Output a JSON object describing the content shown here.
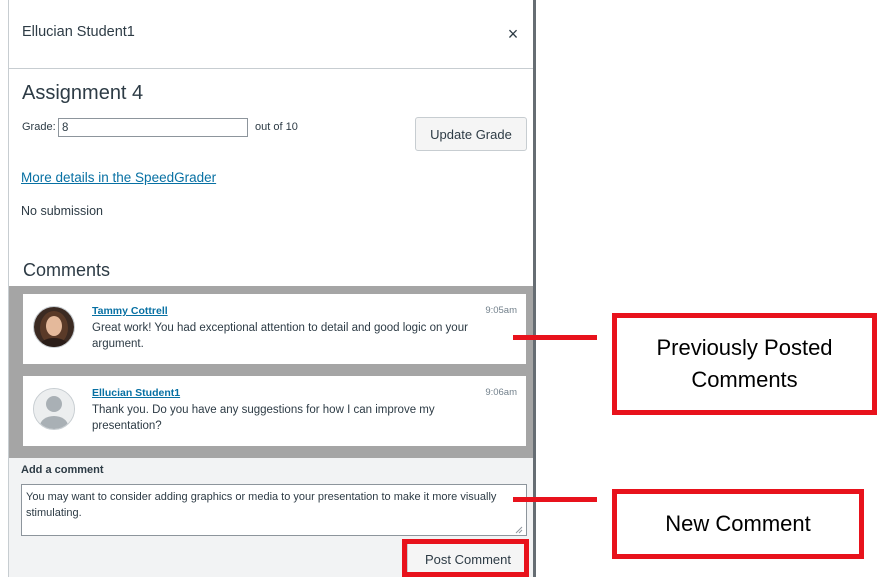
{
  "dialog": {
    "title": "Ellucian Student1",
    "close_label": "×"
  },
  "assignment": {
    "title": "Assignment 4",
    "grade_label": "Grade:",
    "grade_value": "8",
    "out_of": "out of 10",
    "update_button": "Update Grade",
    "details_link": "More details in the SpeedGrader",
    "submission_status": "No submission"
  },
  "comments": {
    "heading": "Comments",
    "items": [
      {
        "author": "Tammy Cottrell",
        "time": "9:05am",
        "text": "Great work! You had exceptional attention to detail and good logic on your argument.",
        "avatar": "user-photo"
      },
      {
        "author": "Ellucian Student1",
        "time": "9:06am",
        "text": "Thank you. Do you have any suggestions for how I can improve my presentation?",
        "avatar": "default-avatar-icon"
      }
    ]
  },
  "add_comment": {
    "label": "Add a comment",
    "value": "You may want to consider adding graphics or media to your presentation to make it more visually stimulating.",
    "post_button": "Post Comment"
  },
  "callouts": {
    "previous": "Previously Posted Comments",
    "new": "New Comment"
  },
  "colors": {
    "accent_link": "#0770a3",
    "annotation_red": "#e8121c",
    "comments_bg": "#a5a5a5"
  }
}
